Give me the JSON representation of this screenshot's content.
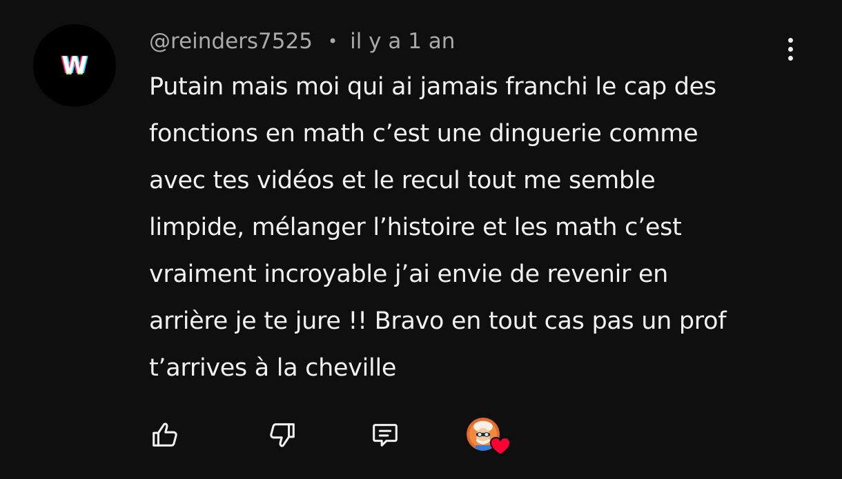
{
  "comment": {
    "author": {
      "avatar_letter": "W",
      "handle": "@reinders7525"
    },
    "separator": "•",
    "timestamp": "il y a 1 an",
    "text_lines": [
      "Putain mais moi qui ai jamais franchi le cap des",
      "fonctions en math c’est une dinguerie comme",
      "avec tes vidéos et le recul tout me semble",
      "limpide, mélanger l’histoire et les math c’est",
      "vraiment incroyable j’ai envie de revenir en",
      "arrière je te jure !! Bravo en tout cas pas un prof",
      "t’arrives à la cheville"
    ],
    "actions": {
      "like_icon": "thumbs-up-icon",
      "dislike_icon": "thumbs-down-icon",
      "reply_icon": "comment-reply-icon",
      "creator_heart_icon": "heart-icon"
    },
    "more_icon": "more-vertical-icon"
  },
  "colors": {
    "background": "#0f0f0f",
    "text_primary": "#f1f1f1",
    "text_secondary": "#aaaaaa",
    "heart": "#ff0033"
  }
}
